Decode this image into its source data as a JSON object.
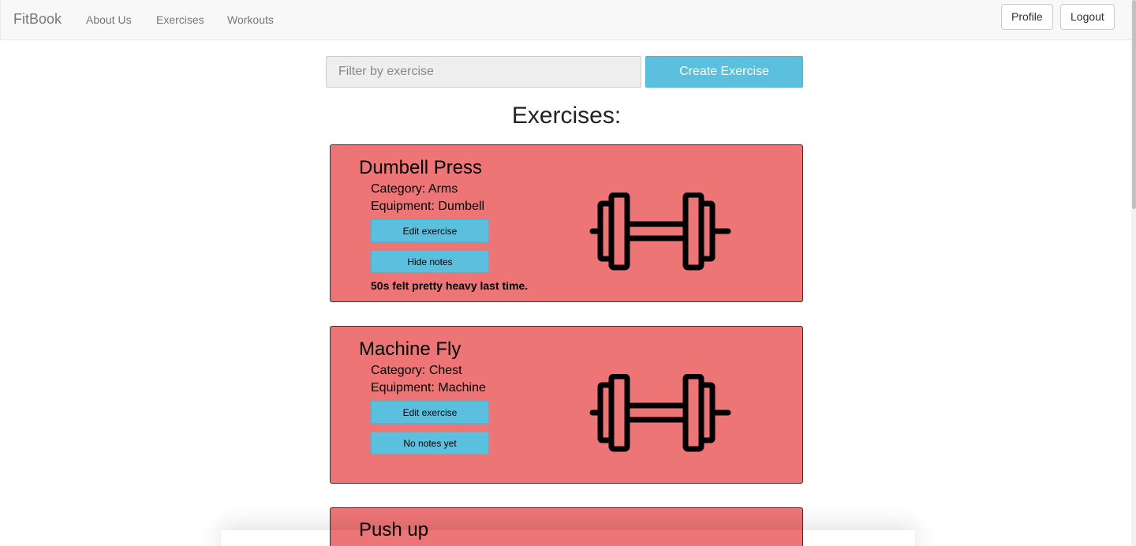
{
  "navbar": {
    "brand": "FitBook",
    "links": [
      "About Us",
      "Exercises",
      "Workouts"
    ],
    "profile_label": "Profile",
    "logout_label": "Logout"
  },
  "filter": {
    "placeholder": "Filter by exercise"
  },
  "create_button_label": "Create Exercise",
  "page_title": "Exercises:",
  "exercises": [
    {
      "name": "Dumbell Press",
      "category": "Category: Arms",
      "equipment": "Equipment: Dumbell",
      "edit_label": "Edit exercise",
      "notes_button_label": "Hide notes",
      "note": "50s felt pretty heavy last time.",
      "icon": "dumbbell-icon"
    },
    {
      "name": "Machine Fly",
      "category": "Category: Chest",
      "equipment": "Equipment: Machine",
      "edit_label": "Edit exercise",
      "notes_button_label": "No notes yet",
      "icon": "dumbbell-icon"
    },
    {
      "name": "Push up"
    }
  ],
  "colors": {
    "accent": "#5bc0de",
    "card": "#ee7575"
  }
}
